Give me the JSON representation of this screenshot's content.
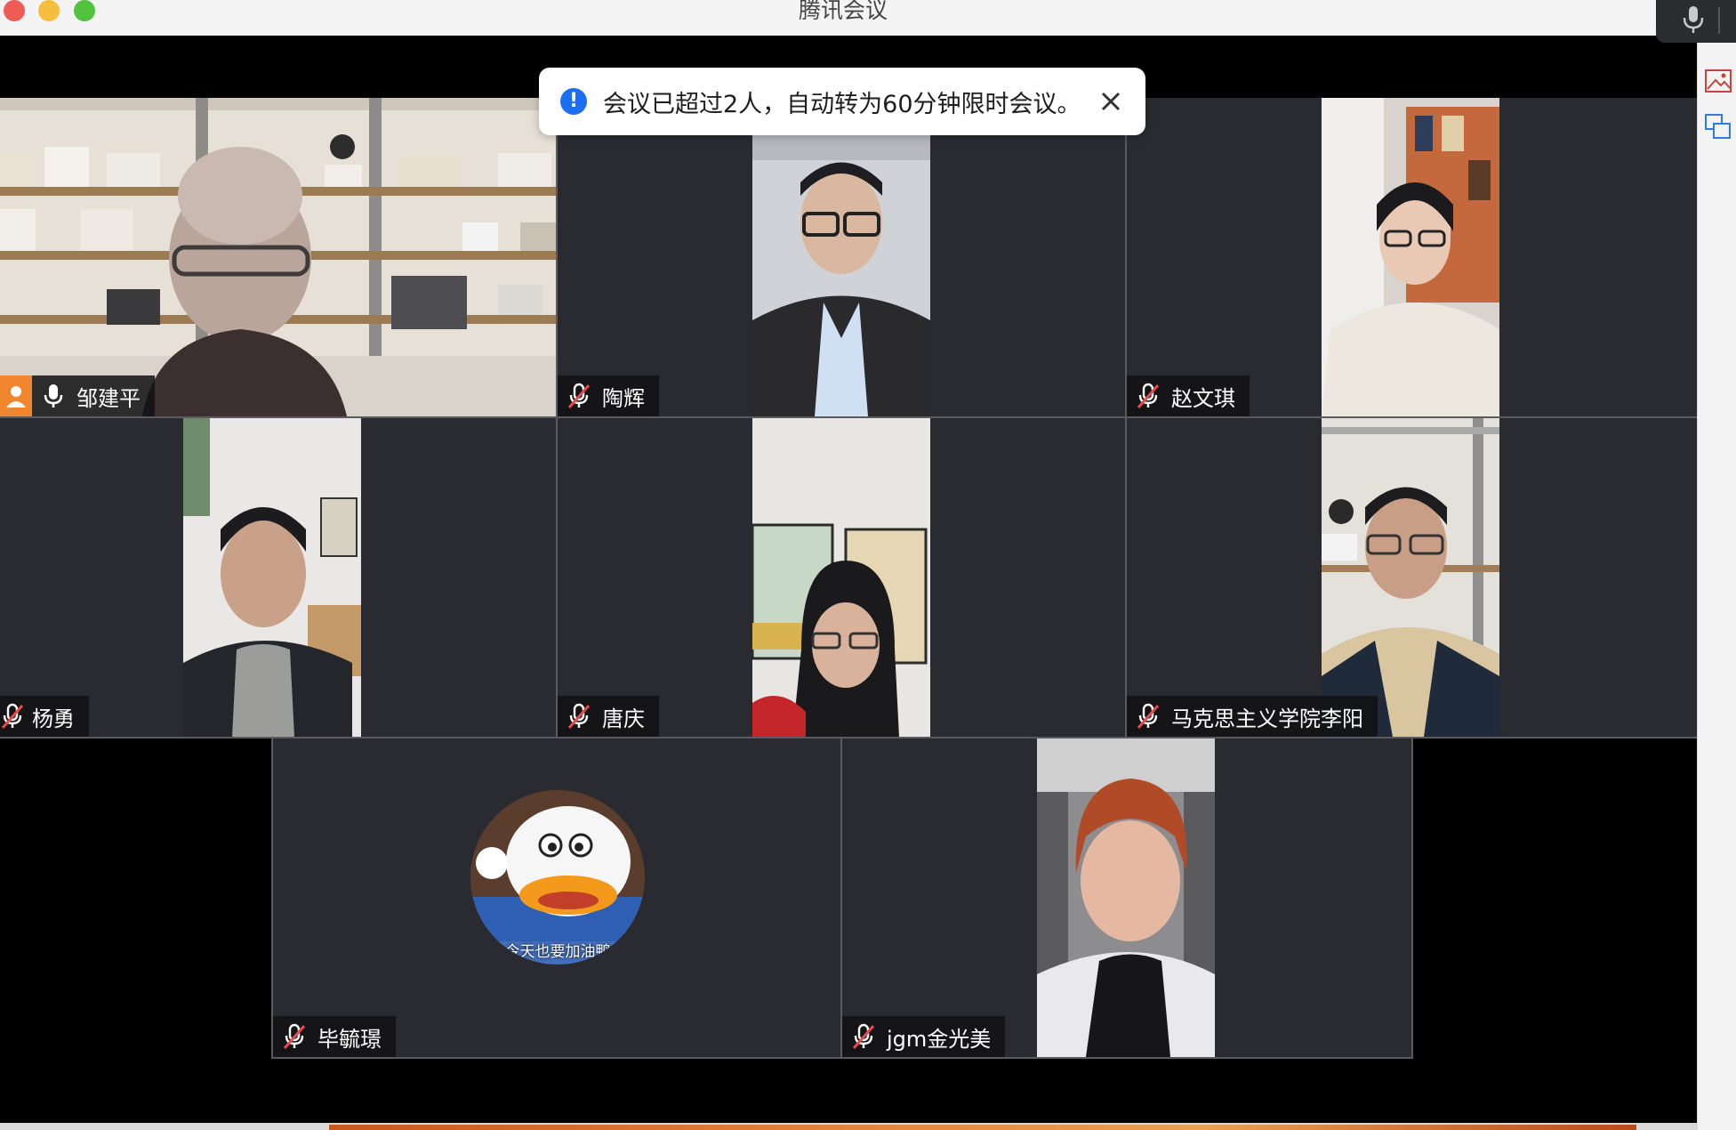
{
  "window": {
    "title": "腾讯会议"
  },
  "notification": {
    "message": "会议已超过2人，自动转为60分钟限时会议。",
    "icon": "info-icon",
    "close_icon": "close-icon"
  },
  "participants": [
    {
      "name": "邹建平",
      "mic": "mic-on-icon",
      "host": true
    },
    {
      "name": "陶辉",
      "mic": "mic-muted-icon",
      "host": false
    },
    {
      "name": "赵文琪",
      "mic": "mic-muted-icon",
      "host": false
    },
    {
      "name": "杨勇",
      "mic": "mic-muted-icon",
      "host": false
    },
    {
      "name": "唐庆",
      "mic": "mic-muted-icon",
      "host": false
    },
    {
      "name": "马克思主义学院李阳",
      "mic": "mic-muted-icon",
      "host": false
    },
    {
      "name": "毕毓璟",
      "mic": "mic-muted-icon",
      "host": false,
      "avatar_caption": "今天也要加油鸭"
    },
    {
      "name": "jgm金光美",
      "mic": "mic-muted-icon",
      "host": false
    }
  ],
  "colors": {
    "tile_bg": "#2a2b30",
    "host_badge": "#f0872e",
    "info_blue": "#1d6ff2"
  }
}
